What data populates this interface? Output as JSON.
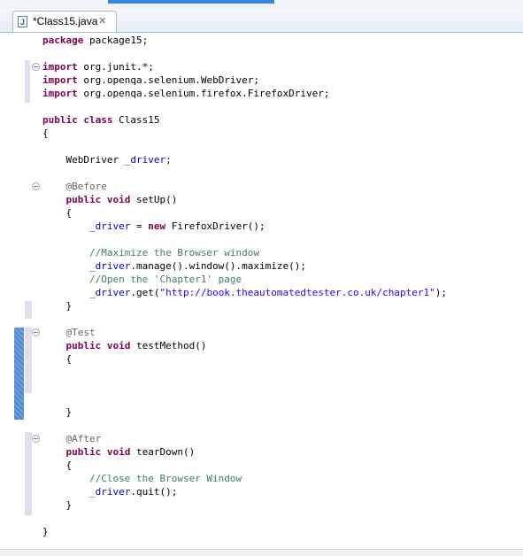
{
  "editor": {
    "tab": {
      "title": "*Class15.java",
      "close_icon": "close-icon",
      "file_icon": "java-file-icon",
      "file_icon_letter": "J"
    },
    "lines": [
      [
        {
          "t": "package",
          "c": "kw"
        },
        {
          "t": " package15;"
        }
      ],
      [],
      [
        {
          "t": "import",
          "c": "kw"
        },
        {
          "t": " org.junit.*;"
        }
      ],
      [
        {
          "t": "import",
          "c": "kw"
        },
        {
          "t": " org.openqa.selenium.WebDriver;"
        }
      ],
      [
        {
          "t": "import",
          "c": "kw"
        },
        {
          "t": " org.openqa.selenium.firefox.FirefoxDriver;"
        }
      ],
      [],
      [
        {
          "t": "public",
          "c": "kw"
        },
        {
          "t": " "
        },
        {
          "t": "class",
          "c": "kw"
        },
        {
          "t": " Class15"
        }
      ],
      [
        {
          "t": "{"
        }
      ],
      [],
      [
        {
          "t": "    WebDriver "
        },
        {
          "t": "_driver",
          "c": "fld"
        },
        {
          "t": ";"
        }
      ],
      [],
      [
        {
          "t": "    "
        },
        {
          "t": "@Before",
          "c": "ann"
        }
      ],
      [
        {
          "t": "    "
        },
        {
          "t": "public",
          "c": "kw"
        },
        {
          "t": " "
        },
        {
          "t": "void",
          "c": "kw"
        },
        {
          "t": " setUp()"
        }
      ],
      [
        {
          "t": "    {"
        }
      ],
      [
        {
          "t": "        "
        },
        {
          "t": "_driver",
          "c": "fld"
        },
        {
          "t": " = "
        },
        {
          "t": "new",
          "c": "kw"
        },
        {
          "t": " FirefoxDriver();"
        }
      ],
      [],
      [
        {
          "t": "        "
        },
        {
          "t": "//Maximize the Browser window",
          "c": "cmt"
        }
      ],
      [
        {
          "t": "        "
        },
        {
          "t": "_driver",
          "c": "fld"
        },
        {
          "t": ".manage().window().maximize();"
        }
      ],
      [
        {
          "t": "        "
        },
        {
          "t": "//Open the 'Chapter1' page",
          "c": "cmt"
        }
      ],
      [
        {
          "t": "        "
        },
        {
          "t": "_driver",
          "c": "fld"
        },
        {
          "t": ".get("
        },
        {
          "t": "\"http://book.theautomatedtester.co.uk/chapter1\"",
          "c": "str"
        },
        {
          "t": ");"
        }
      ],
      [
        {
          "t": "    }"
        }
      ],
      [],
      [
        {
          "t": "    "
        },
        {
          "t": "@Test",
          "c": "ann"
        }
      ],
      [
        {
          "t": "    "
        },
        {
          "t": "public",
          "c": "kw"
        },
        {
          "t": " "
        },
        {
          "t": "void",
          "c": "kw"
        },
        {
          "t": " testMethod()"
        }
      ],
      [
        {
          "t": "    {"
        }
      ],
      [],
      [],
      [],
      [
        {
          "t": "    }"
        }
      ],
      [],
      [
        {
          "t": "    "
        },
        {
          "t": "@After",
          "c": "ann"
        }
      ],
      [
        {
          "t": "    "
        },
        {
          "t": "public",
          "c": "kw"
        },
        {
          "t": " "
        },
        {
          "t": "void",
          "c": "kw"
        },
        {
          "t": " tearDown()"
        }
      ],
      [
        {
          "t": "    {"
        }
      ],
      [
        {
          "t": "        "
        },
        {
          "t": "//Close the Browser Window",
          "c": "cmt"
        }
      ],
      [
        {
          "t": "        "
        },
        {
          "t": "_driver",
          "c": "fld"
        },
        {
          "t": ".quit();"
        }
      ],
      [
        {
          "t": "    }"
        }
      ],
      [],
      [
        {
          "t": "}"
        }
      ]
    ],
    "fold_lines": [
      2,
      11,
      22,
      30
    ],
    "colors": {
      "keyword": "#7f0055",
      "field": "#0000c0",
      "comment": "#3f7f5f",
      "string": "#2a00ff",
      "annotation": "#646464"
    }
  }
}
